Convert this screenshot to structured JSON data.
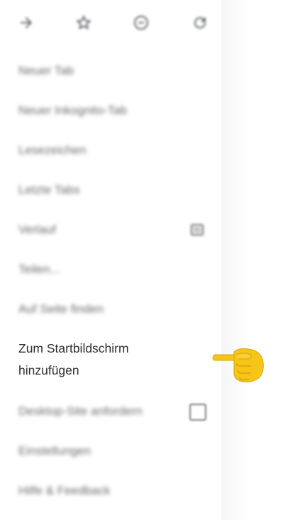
{
  "toolbar": {
    "icons": [
      "forward-icon",
      "bookmark-star-icon",
      "download-info-icon",
      "reload-icon"
    ]
  },
  "menu": {
    "items": [
      {
        "label": "Neuer Tab"
      },
      {
        "label": "Neuer Inkognito-Tab"
      },
      {
        "label": "Lesezeichen"
      },
      {
        "label": "Letzte Tabs"
      },
      {
        "label": "Verlauf"
      },
      {
        "label": "Teilen..."
      },
      {
        "label": "Auf Seite finden"
      },
      {
        "label_line1": "Zum Startbildschirm",
        "label_line2": "hinzufügen"
      },
      {
        "label": "Desktop-Site anfordern"
      },
      {
        "label": "Einstellungen"
      },
      {
        "label": "Hilfe & Feedback"
      }
    ]
  },
  "annotation": {
    "emoji": "👉",
    "color": "#f5c518"
  }
}
